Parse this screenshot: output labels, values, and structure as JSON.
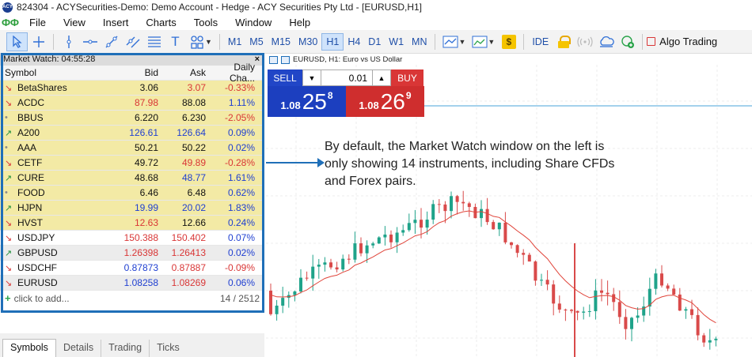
{
  "window": {
    "title": "824304 - ACYSecurities-Demo: Demo Account - Hedge - ACY Securities Pty Ltd - [EURUSD,H1]",
    "app_icon_label": "ACY"
  },
  "menu": {
    "logo": "ФФ",
    "items": [
      "File",
      "View",
      "Insert",
      "Charts",
      "Tools",
      "Window",
      "Help"
    ]
  },
  "toolbar": {
    "timeframes": [
      "M1",
      "M5",
      "M15",
      "M30",
      "H1",
      "H4",
      "D1",
      "W1",
      "MN"
    ],
    "selected_timeframe": "H1",
    "ide_label": "IDE",
    "dollar_label": "$",
    "algo_label": "Algo Trading",
    "text_tool_label": "T"
  },
  "market_watch": {
    "title": "Market Watch: 04:55:28",
    "close": "×",
    "columns": [
      "Symbol",
      "Bid",
      "Ask",
      "Daily Cha..."
    ],
    "rows": [
      {
        "symbol": "BetaShares",
        "dir": "down",
        "bid": "3.06",
        "ask": "3.07",
        "change": "-0.33%",
        "style": "hl",
        "bid_color": "black",
        "ask_color": "red",
        "change_color": "red"
      },
      {
        "symbol": "ACDC",
        "dir": "down",
        "bid": "87.98",
        "ask": "88.08",
        "change": "1.11%",
        "style": "hl",
        "bid_color": "red",
        "ask_color": "black",
        "change_color": "blue"
      },
      {
        "symbol": "BBUS",
        "dir": "flat",
        "bid": "6.220",
        "ask": "6.230",
        "change": "-2.05%",
        "style": "hl",
        "bid_color": "black",
        "ask_color": "black",
        "change_color": "red"
      },
      {
        "symbol": "A200",
        "dir": "up",
        "bid": "126.61",
        "ask": "126.64",
        "change": "0.09%",
        "style": "hl",
        "bid_color": "blue",
        "ask_color": "blue",
        "change_color": "blue"
      },
      {
        "symbol": "AAA",
        "dir": "flat",
        "bid": "50.21",
        "ask": "50.22",
        "change": "0.02%",
        "style": "hl",
        "bid_color": "black",
        "ask_color": "black",
        "change_color": "blue"
      },
      {
        "symbol": "CETF",
        "dir": "down",
        "bid": "49.72",
        "ask": "49.89",
        "change": "-0.28%",
        "style": "hl",
        "bid_color": "black",
        "ask_color": "red",
        "change_color": "red"
      },
      {
        "symbol": "CURE",
        "dir": "up",
        "bid": "48.68",
        "ask": "48.77",
        "change": "1.61%",
        "style": "hl",
        "bid_color": "black",
        "ask_color": "blue",
        "change_color": "blue"
      },
      {
        "symbol": "FOOD",
        "dir": "flat",
        "bid": "6.46",
        "ask": "6.48",
        "change": "0.62%",
        "style": "hl",
        "bid_color": "black",
        "ask_color": "black",
        "change_color": "blue"
      },
      {
        "symbol": "HJPN",
        "dir": "up",
        "bid": "19.99",
        "ask": "20.02",
        "change": "1.83%",
        "style": "hl",
        "bid_color": "blue",
        "ask_color": "blue",
        "change_color": "blue"
      },
      {
        "symbol": "HVST",
        "dir": "down",
        "bid": "12.63",
        "ask": "12.66",
        "change": "0.24%",
        "style": "hl",
        "bid_color": "red",
        "ask_color": "black",
        "change_color": "blue"
      },
      {
        "symbol": "USDJPY",
        "dir": "down",
        "bid": "150.388",
        "ask": "150.402",
        "change": "0.07%",
        "style": "plain",
        "bid_color": "red",
        "ask_color": "red",
        "change_color": "blue"
      },
      {
        "symbol": "GBPUSD",
        "dir": "up",
        "bid": "1.26398",
        "ask": "1.26413",
        "change": "0.02%",
        "style": "alt",
        "bid_color": "red",
        "ask_color": "red",
        "change_color": "blue"
      },
      {
        "symbol": "USDCHF",
        "dir": "down",
        "bid": "0.87873",
        "ask": "0.87887",
        "change": "-0.09%",
        "style": "plain",
        "bid_color": "blue",
        "ask_color": "red",
        "change_color": "red"
      },
      {
        "symbol": "EURUSD",
        "dir": "down",
        "bid": "1.08258",
        "ask": "1.08269",
        "change": "0.06%",
        "style": "alt",
        "bid_color": "blue",
        "ask_color": "red",
        "change_color": "blue"
      }
    ],
    "add_label": "click to add...",
    "count": "14 / 2512",
    "tabs": [
      "Symbols",
      "Details",
      "Trading",
      "Ticks"
    ],
    "active_tab": "Symbols"
  },
  "chart": {
    "title": "EURUSD, H1:  Euro vs US Dollar",
    "one_click": {
      "sell_label": "SELL",
      "buy_label": "BUY",
      "lot": "0.01",
      "sell_price": {
        "prefix": "1.08",
        "big": "25",
        "sup": "8"
      },
      "buy_price": {
        "prefix": "1.08",
        "big": "26",
        "sup": "9"
      }
    }
  },
  "annotation": {
    "lines": [
      "By default, the Market Watch window on the left is",
      "only showing 14 instruments, including Share CFDs",
      "and Forex pairs."
    ]
  }
}
